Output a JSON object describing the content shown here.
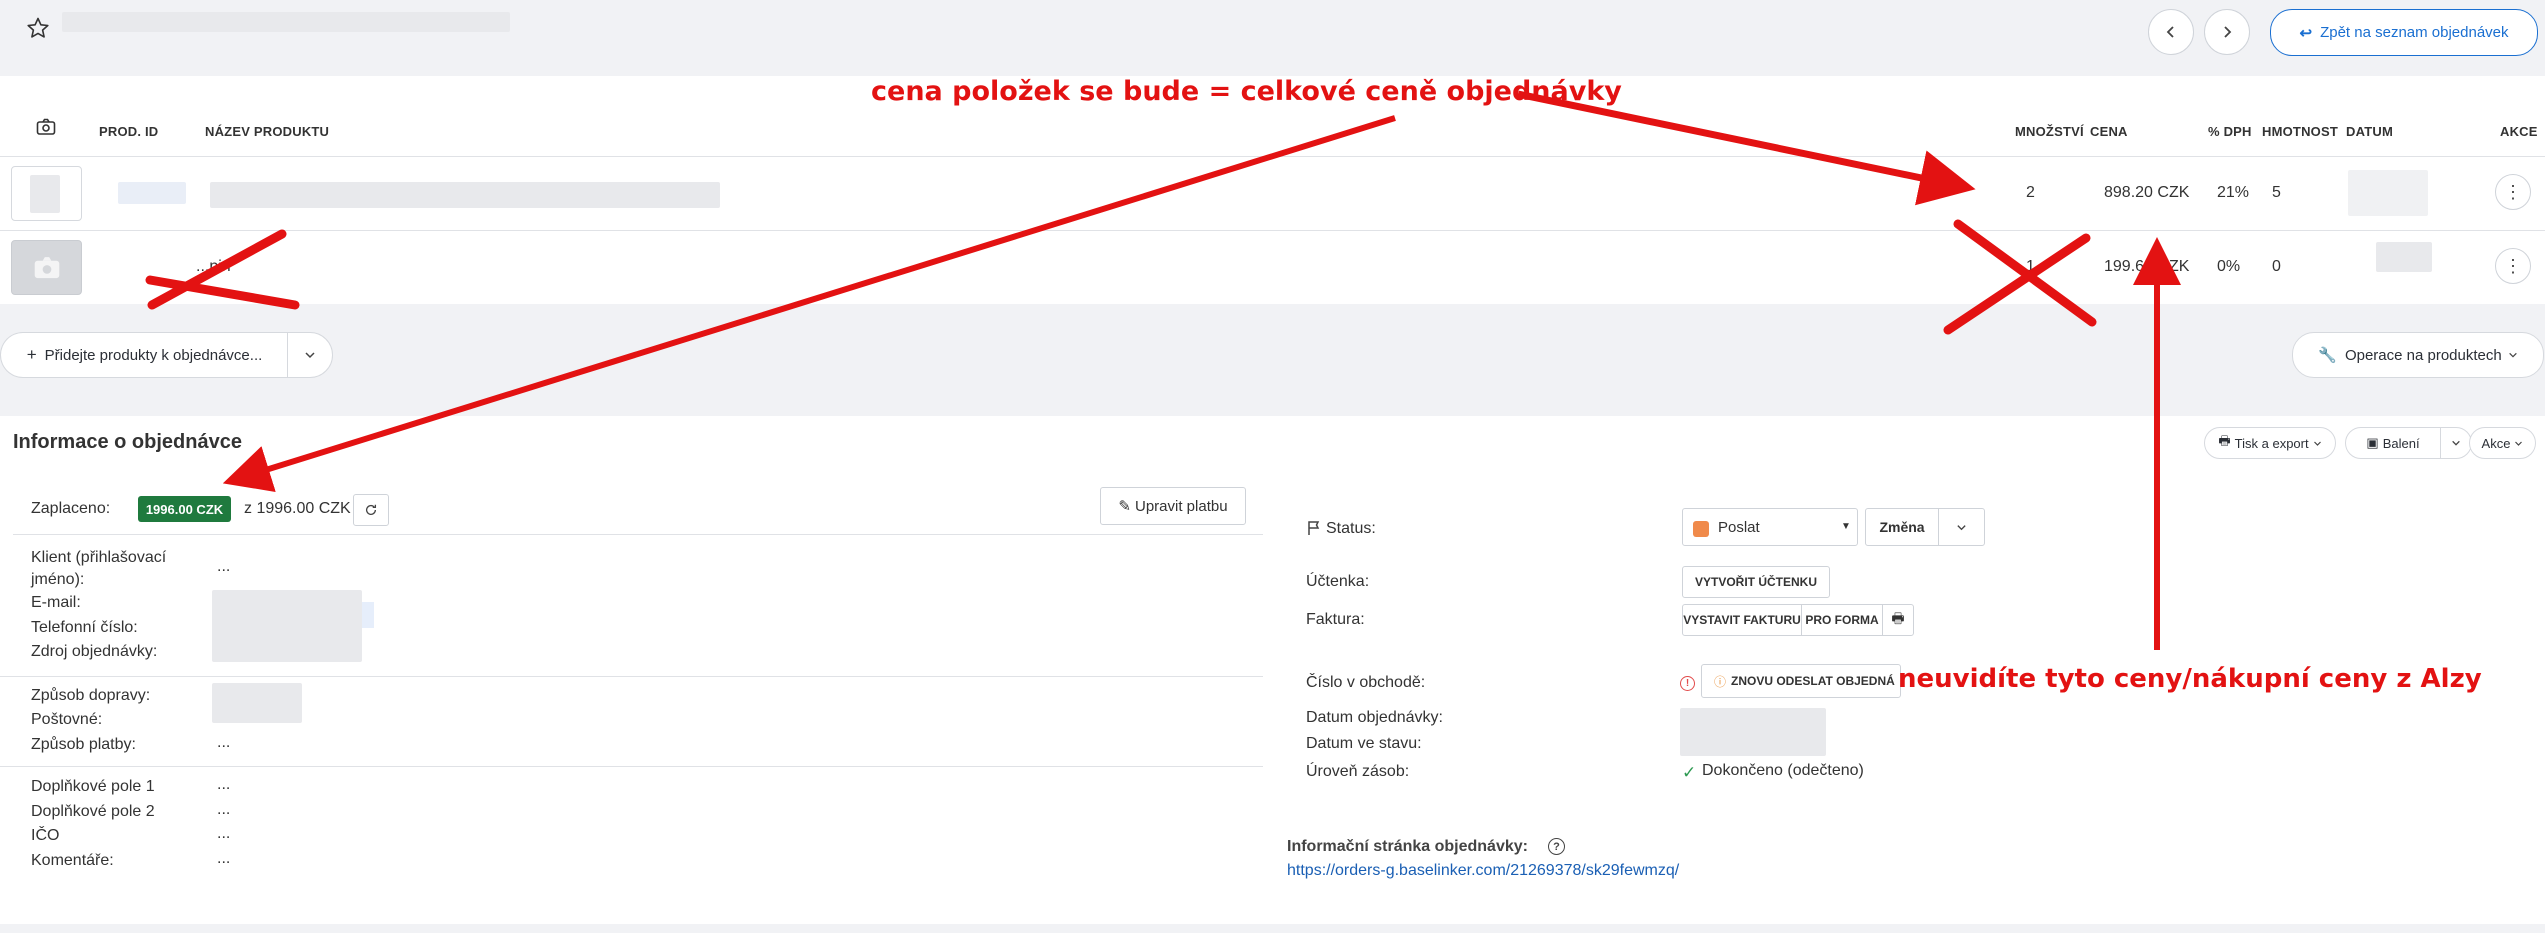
{
  "header": {
    "back_label": "Zpět na seznam objednávek"
  },
  "table": {
    "headers": {
      "prod_id": "PROD. ID",
      "name": "NÁZEV PRODUKTU",
      "qty": "MNOŽSTVÍ",
      "price": "CENA",
      "vat": "% DPH",
      "weight": "HMOTNOST",
      "date": "DATUM",
      "actions": "AKCE"
    },
    "rows": [
      {
        "qty": "2",
        "price": "898.20 CZK",
        "vat": "21%",
        "weight": "5"
      },
      {
        "name": "...pin",
        "qty": "1",
        "price": "199.60 CZK",
        "vat": "0%",
        "weight": "0"
      }
    ]
  },
  "toolbar": {
    "add_products": "Přidejte produkty k objednávce...",
    "product_ops": "Operace na produktech"
  },
  "order_info": {
    "title": "Informace o objednávce",
    "print_export": "Tisk a export",
    "packing": "Balení",
    "actions": "Akce",
    "paid_label": "Zaplaceno:",
    "paid_badge": "1996.00 CZK",
    "paid_of": "z 1996.00 CZK",
    "edit_payment": "Upravit platbu",
    "client_label": "Klient (přihlašovací jméno):",
    "client_value": "...",
    "email_label": "E-mail:",
    "phone_label": "Telefonní číslo:",
    "source_label": "Zdroj objednávky:",
    "shipping_label": "Způsob dopravy:",
    "postage_label": "Poštovné:",
    "payment_label": "Způsob platby:",
    "payment_value": "...",
    "extra1_label": "Doplňkové pole 1",
    "extra1_value": "...",
    "extra2_label": "Doplňkové pole 2",
    "extra2_value": "...",
    "ico_label": "IČO",
    "ico_value": "...",
    "comments_label": "Komentáře:",
    "comments_value": "...",
    "status_label": "Status:",
    "status_value": "Poslat",
    "status_color": "#f08a4b",
    "change_label": "Změna",
    "receipt_label": "Účtenka:",
    "create_receipt": "VYTVOŘIT ÚČTENKU",
    "invoice_label": "Faktura:",
    "issue_invoice": "VYSTAVIT FAKTURU",
    "proforma": "PRO FORMA",
    "shop_number_label": "Číslo v obchodě:",
    "resend_order": "ZNOVU ODESLAT OBJEDNÁ",
    "order_date_label": "Datum objednávky:",
    "status_date_label": "Datum ve stavu:",
    "stock_level_label": "Úroveň zásob:",
    "stock_level_value": "Dokončeno (odečteno)",
    "info_page_label": "Informační stránka objednávky:",
    "info_page_url": "https://orders-g.baselinker.com/21269378/sk29fewmzq/"
  },
  "annotations": {
    "top": "cena položek se bude = celkové ceně objednávky",
    "right": "neuvidíte tyto ceny/nákupní ceny z Alzy",
    "color": "#e31212"
  },
  "colors": {
    "accent": "#1a6fd1",
    "paid_badge": "#1f7a3e",
    "link": "#1a5fb4"
  }
}
